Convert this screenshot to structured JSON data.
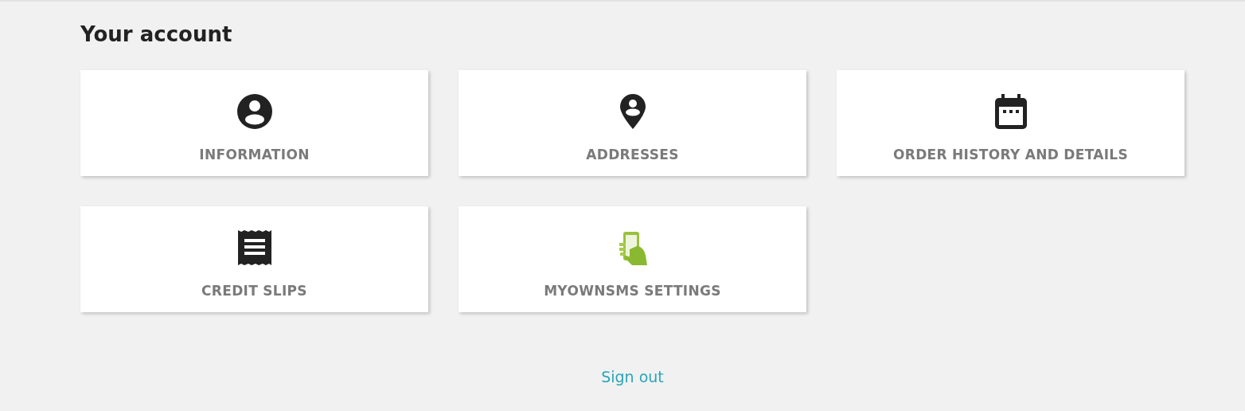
{
  "title": "Your account",
  "tiles": [
    {
      "label": "INFORMATION",
      "kind": "person"
    },
    {
      "label": "ADDRESSES",
      "kind": "pin"
    },
    {
      "label": "ORDER HISTORY AND DETAILS",
      "kind": "calendar"
    },
    {
      "label": "CREDIT SLIPS",
      "kind": "receipt"
    },
    {
      "label": "MYOWNSMS SETTINGS",
      "kind": "phone"
    }
  ],
  "sign_out": "Sign out"
}
